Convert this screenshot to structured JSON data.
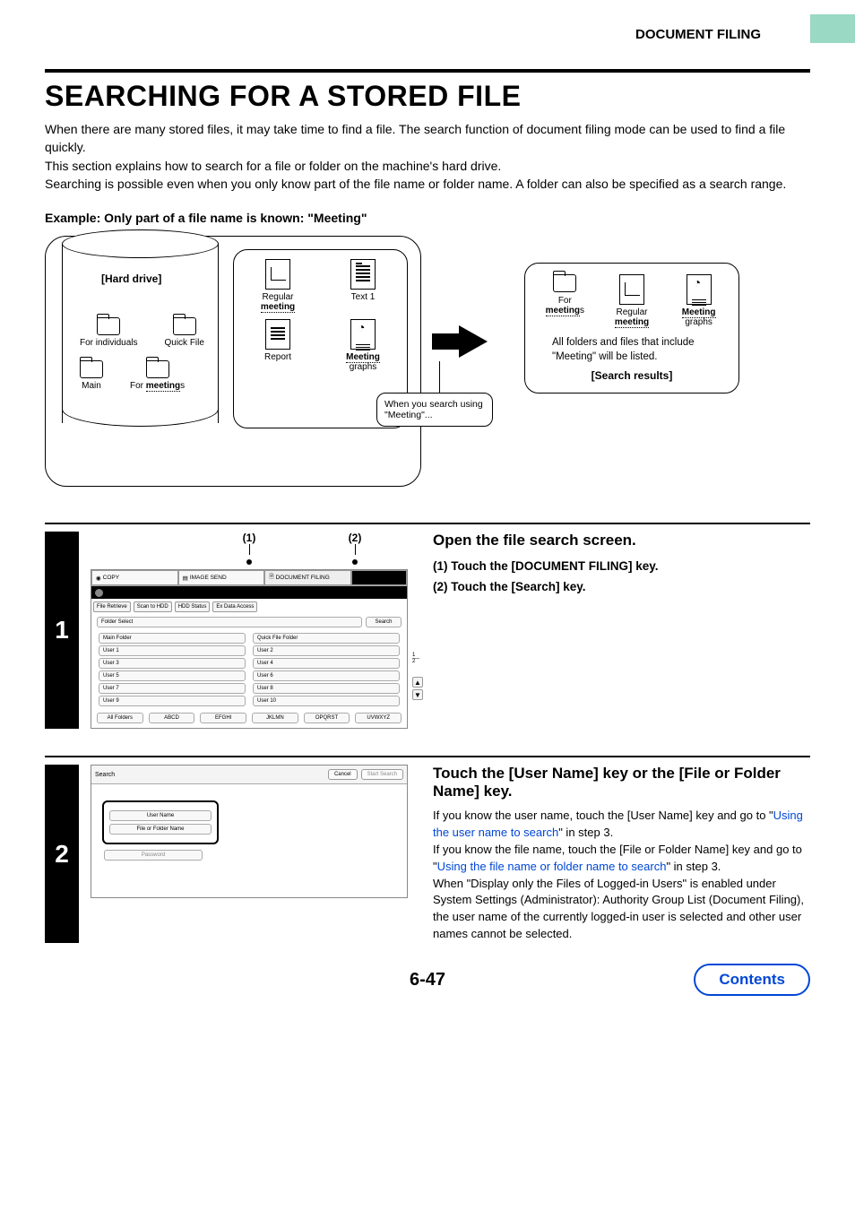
{
  "header": {
    "section": "DOCUMENT FILING"
  },
  "title": "SEARCHING FOR A STORED FILE",
  "intro": {
    "p1": "When there are many stored files, it may take time to find a file. The search function of document filing mode can be used to find a file quickly.",
    "p2": "This section explains how to search for a file or folder on the machine's hard drive.",
    "p3": "Searching is possible even when you only know part of the file name or folder name. A folder can also be specified as a search range."
  },
  "example_label": "Example: Only part of a file name is known: \"Meeting\"",
  "diagram": {
    "hard_drive_label": "[Hard drive]",
    "folders": {
      "f1": "For individuals",
      "f2": "Quick File",
      "f3": "Main",
      "f4_prefix": "For ",
      "f4_bold": "meeting",
      "f4_suffix": "s"
    },
    "files": {
      "file1_prefix": "Regular ",
      "file1_bold": "meeting",
      "file2": "Text 1",
      "file3": "Report",
      "file4_bold": "Meeting",
      "file4_suffix": " graphs"
    },
    "callout": "When you search using \"Meeting\"...",
    "results": {
      "r1_prefix": "For",
      "r1_bold": "meeting",
      "r1_suffix": "s",
      "r2_prefix": "Regular",
      "r2_bold": "meeting",
      "r3_bold": "Meeting",
      "r3_suffix": "graphs",
      "note": "All folders and files that include \"Meeting\" will be listed.",
      "label": "[Search results]"
    }
  },
  "step1": {
    "num": "1",
    "marker1": "(1)",
    "marker2": "(2)",
    "heading": "Open the file search screen.",
    "items": {
      "i1": "(1)  Touch the [DOCUMENT FILING] key.",
      "i2": "(2)  Touch the [Search] key."
    },
    "panel": {
      "tabs": {
        "copy": "COPY",
        "image_send": "IMAGE SEND",
        "doc_filing": "DOCUMENT FILING"
      },
      "subtabs": {
        "t1": "File Retrieve",
        "t2": "Scan to HDD",
        "t3": "HDD Status",
        "t4": "Ex Data Access"
      },
      "folder_select": "Folder Select",
      "search": "Search",
      "main_folder": "Main Folder",
      "quick_file_folder": "Quick File Folder",
      "users": {
        "u1": "User 1",
        "u2": "User 2",
        "u3": "User 3",
        "u4": "User 4",
        "u5": "User 5",
        "u6": "User 6",
        "u7": "User 7",
        "u8": "User 8",
        "u9": "User 9",
        "u10": "User 10"
      },
      "page_top": "1",
      "page_bot": "2",
      "alpha": {
        "a0": "All Folders",
        "a1": "ABCD",
        "a2": "EFGHI",
        "a3": "JKLMN",
        "a4": "OPQRST",
        "a5": "UVWXYZ"
      }
    }
  },
  "step2": {
    "num": "2",
    "heading": "Touch the [User Name] key or the [File or Folder Name] key.",
    "body": {
      "p1a": "If you know the user name, touch the [User Name] key and go to \"",
      "link1": "Using the user name to search",
      "p1b": "\" in step 3.",
      "p2a": "If you know the file name, touch the [File or Folder Name] key and go to \"",
      "link2": "Using the file name or folder name to search",
      "p2b": "\" in step 3.",
      "p3": "When \"Display only the Files of Logged-in Users\" is enabled under System Settings (Administrator): Authority Group List (Document Filing), the user name of the currently logged-in user is selected and other user names cannot be selected."
    },
    "panel": {
      "title": "Search",
      "cancel": "Cancel",
      "start": "Start Search",
      "user_name": "User Name",
      "file_folder": "File or Folder Name",
      "password": "Password"
    }
  },
  "page_num": "6-47",
  "contents": "Contents"
}
